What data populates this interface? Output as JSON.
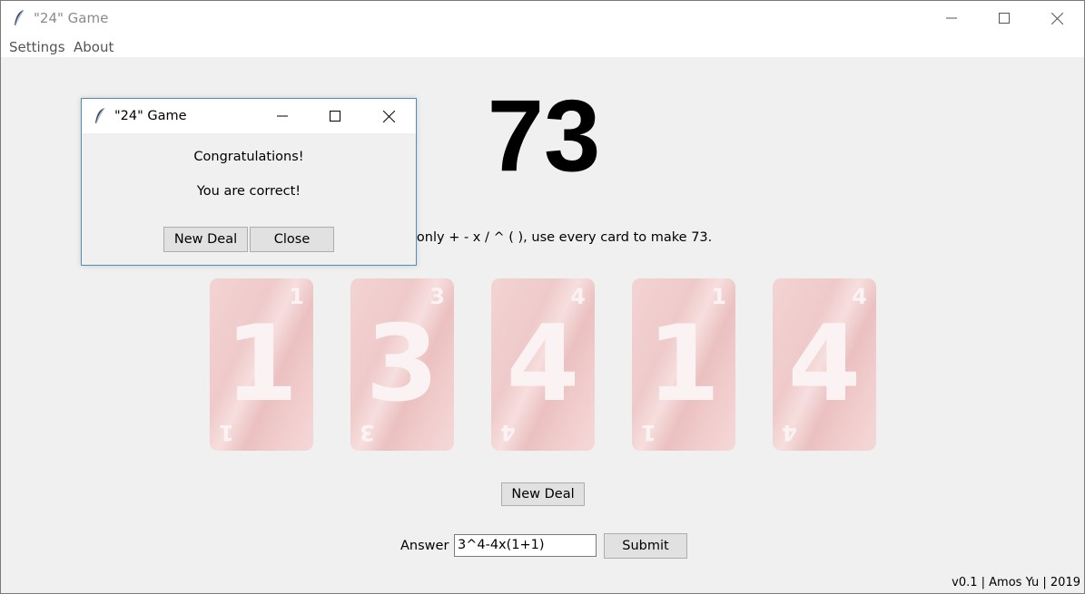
{
  "window": {
    "title": "\"24\" Game",
    "controls": [
      "minimize-icon",
      "maximize-icon",
      "close-icon"
    ]
  },
  "menu": {
    "items": [
      {
        "label": "Settings"
      },
      {
        "label": "About"
      }
    ]
  },
  "game": {
    "target": "73",
    "instruction": "Using only + - x / ^ ( ), use every card to make 73.",
    "cards": [
      {
        "value": "1"
      },
      {
        "value": "3"
      },
      {
        "value": "4"
      },
      {
        "value": "1"
      },
      {
        "value": "4"
      }
    ],
    "new_deal_label": "New Deal",
    "answer_label": "Answer",
    "answer_value": "3^4-4x(1+1)",
    "submit_label": "Submit",
    "footer": "v0.1 | Amos Yu | 2019"
  },
  "dialog": {
    "title": "\"24\" Game",
    "message_1": "Congratulations!",
    "message_2": "You are correct!",
    "new_deal_label": "New Deal",
    "close_label": "Close"
  },
  "colors": {
    "card_bg": "#efcaca",
    "card_text": "#fbf3f3",
    "button_bg": "#e1e1e1",
    "dialog_border": "#4a90b8"
  }
}
